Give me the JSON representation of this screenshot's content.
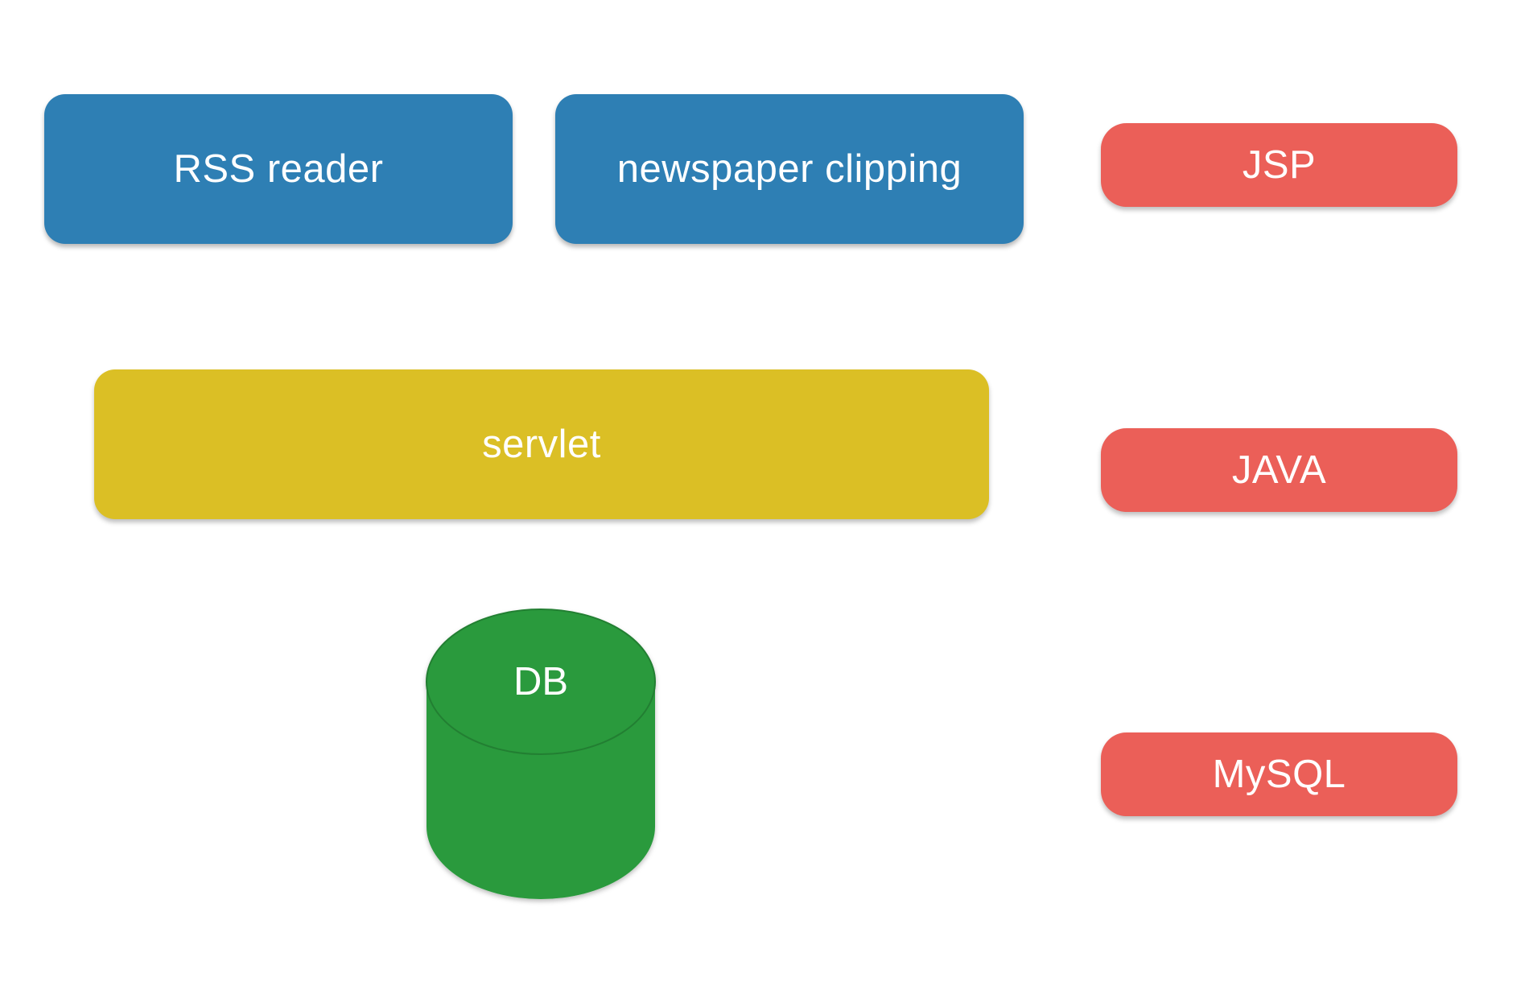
{
  "layers": {
    "presentation": [
      {
        "label": "RSS reader"
      },
      {
        "label": "newspaper clipping"
      }
    ],
    "logic": {
      "label": "servlet"
    },
    "storage": {
      "label": "DB"
    }
  },
  "technologies": [
    {
      "label": "JSP"
    },
    {
      "label": "JAVA"
    },
    {
      "label": "MySQL"
    }
  ],
  "colors": {
    "presentation": "#2e7fb4",
    "logic": "#dbbf25",
    "storage": "#2b9a3d",
    "technology": "#eb5f58"
  }
}
